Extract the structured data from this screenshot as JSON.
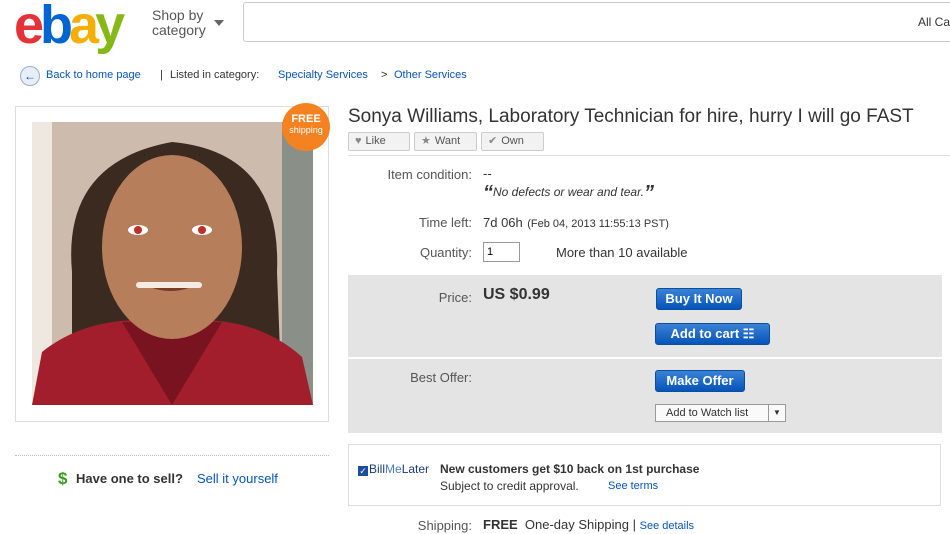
{
  "header": {
    "logo": {
      "e": "e",
      "b": "b",
      "a": "a",
      "y": "y"
    },
    "shop_by_line1": "Shop by",
    "shop_by_line2": "category",
    "search_placeholder": "",
    "category_select": "All Ca"
  },
  "breadcrumb": {
    "back": "Back to home page",
    "separator": "|",
    "listed": "Listed in category:",
    "cat1": "Specialty Services",
    "arrow": ">",
    "cat2": "Other Services"
  },
  "badge": {
    "line1": "FREE",
    "line2": "shipping"
  },
  "item": {
    "title": "Sonya Williams, Laboratory Technician for hire, hurry I will go FAST",
    "like": "Like",
    "want": "Want",
    "own": "Own",
    "condition_label": "Item condition:",
    "condition_value": "--",
    "condition_note": "No defects or wear and tear.",
    "time_label": "Time left:",
    "time_value": "7d 06h",
    "time_detail": "(Feb 04, 2013  11:55:13 PST)",
    "qty_label": "Quantity:",
    "qty_value": "1",
    "qty_available": "More than 10 available",
    "price_label": "Price:",
    "price_value": "US $0.99",
    "buy_now": "Buy It Now",
    "add_to_cart": "Add to cart",
    "best_offer_label": "Best Offer:",
    "make_offer": "Make Offer",
    "watch": "Add to Watch list"
  },
  "bml": {
    "logo_bill": "Bill",
    "logo_me": "Me",
    "logo_later": "Later",
    "headline": "New customers get $10 back on 1st purchase",
    "sub": "Subject to credit approval.",
    "terms": "See terms"
  },
  "shipping": {
    "label": "Shipping:",
    "free": "FREE",
    "method": "One-day Shipping",
    "sep": "|",
    "details": "See details"
  },
  "sell": {
    "dollar": "$",
    "question": "Have one to sell?",
    "link": "Sell it yourself"
  },
  "colors": {
    "ebay_red": "#e53238",
    "ebay_blue": "#0064d2",
    "ebay_yellow": "#f5af02",
    "ebay_green": "#86b817",
    "button_blue": "#0654ba",
    "badge_orange": "#f58220"
  }
}
